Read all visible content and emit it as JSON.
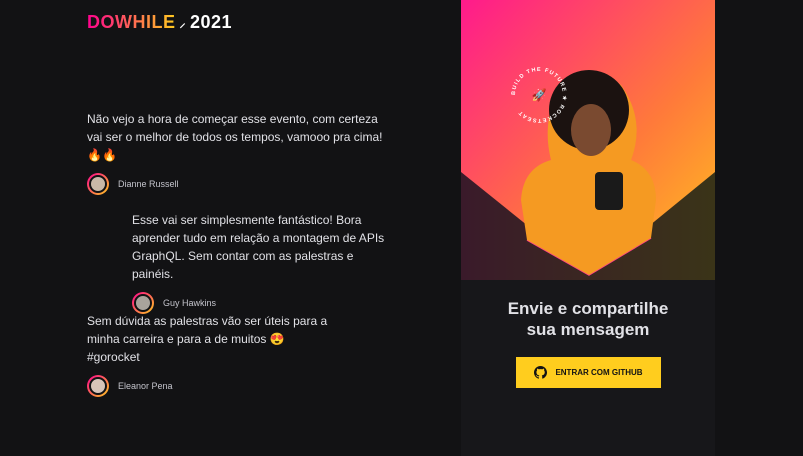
{
  "logo": {
    "brand": "DOWHILE",
    "year": "2021"
  },
  "messages": [
    {
      "text": "Não vejo a hora de começar esse evento, com certeza vai ser o melhor de todos os tempos, vamooo pra cima! 🔥🔥",
      "author": "Dianne Russell"
    },
    {
      "text": "Esse vai ser simplesmente fantástico! Bora aprender tudo em relação a montagem de APIs GraphQL. Sem contar com as palestras e painéis.",
      "author": "Guy Hawkins"
    },
    {
      "text": "Sem dúvida as palestras vão ser úteis para a minha carreira e para a de muitos 😍 #gorocket",
      "author": "Eleanor Pena"
    }
  ],
  "panel": {
    "badge": "BUILD THE FUTURE ★ ROCKETSEAT",
    "cta_line1": "Envie e compartilhe",
    "cta_line2": "sua mensagem",
    "button_label": "ENTRAR COM GITHUB"
  },
  "colors": {
    "accent": "#ffcd1e",
    "pink": "#ff008e",
    "bg": "#121214"
  }
}
